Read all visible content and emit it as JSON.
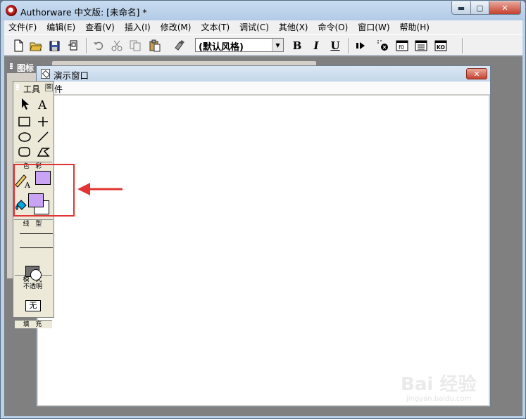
{
  "window": {
    "title": "Authorware 中文版: [未命名] *",
    "min_icon": "minimize-icon",
    "max_icon": "maximize-icon",
    "close_icon": "close-icon",
    "min_glyph": "▬",
    "max_glyph": "▢",
    "close_glyph": "✕"
  },
  "menubar": {
    "items": [
      "文件(F)",
      "编辑(E)",
      "查看(V)",
      "插入(I)",
      "修改(M)",
      "文本(T)",
      "调试(C)",
      "其他(X)",
      "命令(O)",
      "窗口(W)",
      "帮助(H)"
    ]
  },
  "toolbar": {
    "style_select": {
      "value": "(默认风格)",
      "arrow_glyph": "▼"
    },
    "bold": "B",
    "italic": "I",
    "underline": "U",
    "icons": [
      "new-icon",
      "open-icon",
      "save-all-icon",
      "import-icon",
      "undo-icon",
      "cut-icon",
      "copy-icon",
      "paste-icon",
      "find-icon",
      "bold-icon",
      "italic-icon",
      "underline-icon",
      "run-icon",
      "control-panel-icon",
      "functions-icon",
      "variables-icon",
      "knowledge-objects-icon"
    ]
  },
  "icon_panel": {
    "title": "图标"
  },
  "presentation_window": {
    "title": "演示窗口",
    "menu_file": "件",
    "close_glyph": "✕"
  },
  "tools_palette": {
    "title": "工具",
    "close_glyph": "⊠",
    "sections": {
      "color": "色 彩",
      "line": "线 型",
      "mode": "模 式",
      "fill": "填 充"
    },
    "mode_value": "不透明",
    "fill_value": "无"
  },
  "colors": {
    "text_color": "#c9a4f5",
    "foreground_color": "#c9a4f5",
    "background_color": "#ffffff",
    "highlight": "#e23434"
  },
  "watermark": {
    "brand": "Bai 经验",
    "url": "jingyan.baidu.com"
  }
}
